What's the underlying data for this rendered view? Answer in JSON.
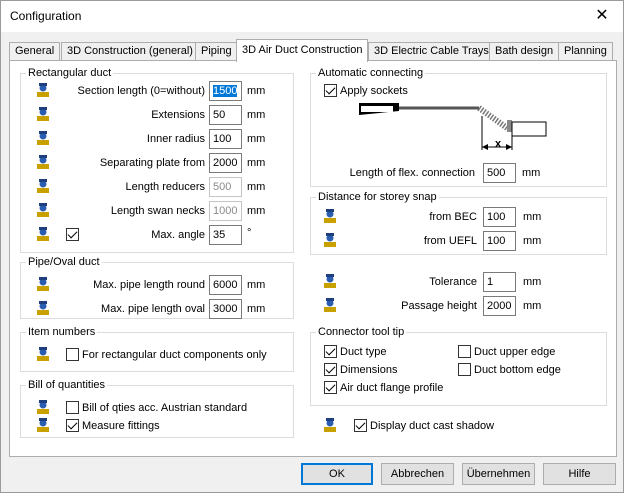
{
  "window": {
    "title": "Configuration"
  },
  "tabs": [
    {
      "label": "General"
    },
    {
      "label": "3D Construction (general)"
    },
    {
      "label": "Piping"
    },
    {
      "label": "3D Air Duct Construction"
    },
    {
      "label": "3D Electric Cable Trays"
    },
    {
      "label": "Bath design"
    },
    {
      "label": "Planning"
    }
  ],
  "rect_duct": {
    "legend": "Rectangular duct",
    "section_length": {
      "label": "Section length (0=without)",
      "value": "1500",
      "unit": "mm"
    },
    "extensions": {
      "label": "Extensions",
      "value": "50",
      "unit": "mm"
    },
    "inner_radius": {
      "label": "Inner radius",
      "value": "100",
      "unit": "mm"
    },
    "separating_plate": {
      "label": "Separating plate from",
      "value": "2000",
      "unit": "mm"
    },
    "length_reducers": {
      "label": "Length reducers",
      "value": "500",
      "unit": "mm"
    },
    "length_swan_necks": {
      "label": "Length swan necks",
      "value": "1000",
      "unit": "mm"
    },
    "max_angle": {
      "label": "Max. angle",
      "value": "35",
      "unit": "°",
      "checked": true
    }
  },
  "pipe_oval": {
    "legend": "Pipe/Oval duct",
    "round": {
      "label": "Max. pipe length round",
      "value": "6000",
      "unit": "mm"
    },
    "oval": {
      "label": "Max. pipe length oval",
      "value": "3000",
      "unit": "mm"
    }
  },
  "item_numbers": {
    "legend": "Item numbers",
    "rect_only": {
      "label": "For rectangular duct components only",
      "checked": false
    }
  },
  "bill": {
    "legend": "Bill of quantities",
    "austrian": {
      "label": "Bill of qties acc. Austrian standard",
      "checked": false
    },
    "fittings": {
      "label": "Measure fittings",
      "checked": true
    }
  },
  "auto_connect": {
    "legend": "Automatic connecting",
    "apply_sockets": {
      "label": "Apply sockets",
      "checked": true
    },
    "flex_length": {
      "label": "Length of flex. connection",
      "value": "500",
      "unit": "mm"
    },
    "diagram_x": "x"
  },
  "storey_snap": {
    "legend": "Distance for storey snap",
    "from_bec": {
      "label": "from BEC",
      "value": "100",
      "unit": "mm"
    },
    "from_uefl": {
      "label": "from UEFL",
      "value": "100",
      "unit": "mm"
    }
  },
  "tolerance": {
    "label": "Tolerance",
    "value": "1",
    "unit": "mm"
  },
  "passage_height": {
    "label": "Passage height",
    "value": "2000",
    "unit": "mm"
  },
  "tooltip": {
    "legend": "Connector tool tip",
    "duct_type": {
      "label": "Duct type",
      "checked": true
    },
    "dimensions": {
      "label": "Dimensions",
      "checked": true
    },
    "flange": {
      "label": "Air duct flange profile",
      "checked": true
    },
    "upper_edge": {
      "label": "Duct upper edge",
      "checked": false
    },
    "bottom_edge": {
      "label": "Duct bottom edge",
      "checked": false
    }
  },
  "cast_shadow": {
    "label": "Display duct cast shadow",
    "checked": true
  },
  "buttons": {
    "ok": "OK",
    "cancel": "Abbrechen",
    "apply": "Übernehmen",
    "help": "Hilfe"
  }
}
